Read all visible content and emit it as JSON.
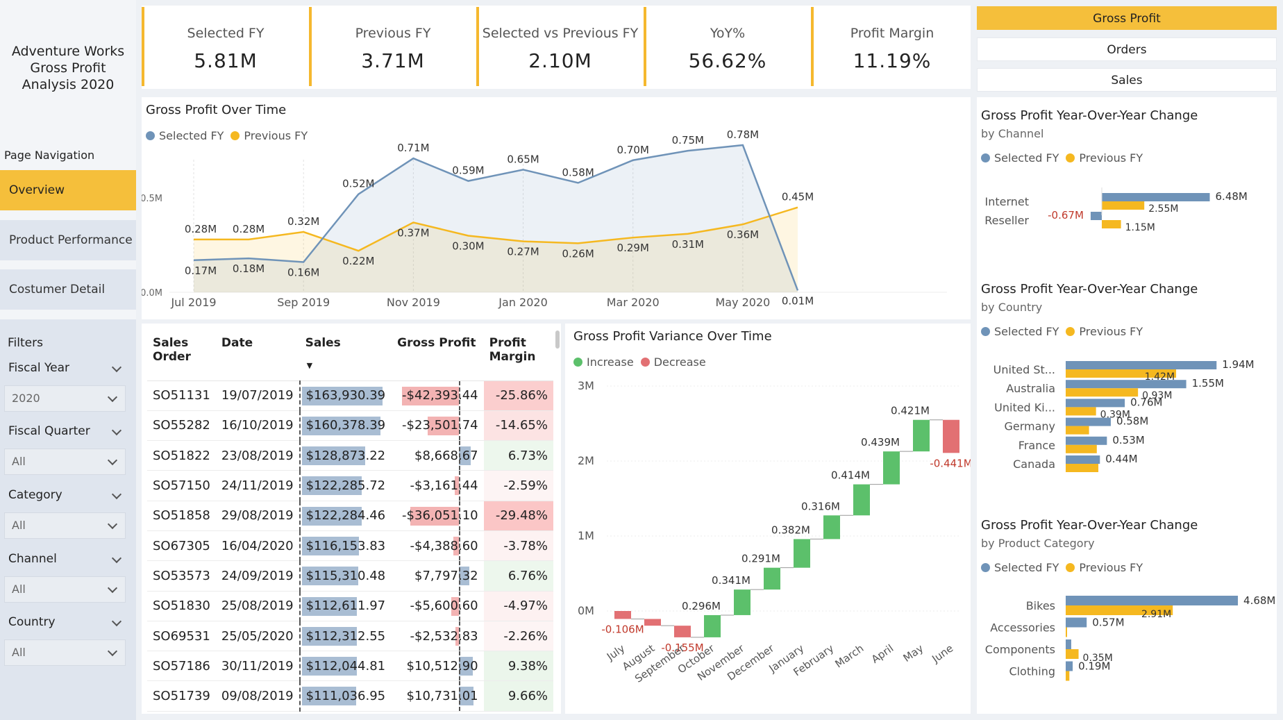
{
  "app": {
    "title_lines": [
      "Adventure Works",
      "Gross Profit",
      "Analysis 2020"
    ]
  },
  "navigation": {
    "heading": "Page Navigation",
    "items": [
      {
        "label": "Overview",
        "active": true
      },
      {
        "label": "Product Performance",
        "active": false
      },
      {
        "label": "Costumer Detail",
        "active": false
      }
    ]
  },
  "filters": {
    "heading": "Filters",
    "items": [
      {
        "label": "Fiscal Year",
        "value": "2020"
      },
      {
        "label": "Fiscal Quarter",
        "value": "All"
      },
      {
        "label": "Category",
        "value": "All"
      },
      {
        "label": "Channel",
        "value": "All"
      },
      {
        "label": "Country",
        "value": "All"
      }
    ]
  },
  "kpis": [
    {
      "label": "Selected FY",
      "value": "5.81M"
    },
    {
      "label": "Previous FY",
      "value": "3.71M"
    },
    {
      "label": "Selected vs Previous FY",
      "value": "2.10M"
    },
    {
      "label": "YoY%",
      "value": "56.62%"
    },
    {
      "label": "Profit Margin",
      "value": "11.19%"
    }
  ],
  "measure_buttons": [
    {
      "label": "Gross Profit",
      "active": true
    },
    {
      "label": "Orders",
      "active": false
    },
    {
      "label": "Sales",
      "active": false
    }
  ],
  "colors": {
    "selected": "#6f93b8",
    "previous": "#f5b820",
    "increase": "#5cc06b",
    "decrease": "#e27073",
    "accent": "#f5bf3b"
  },
  "legend": {
    "selected": "Selected FY",
    "previous": "Previous FY",
    "increase": "Increase",
    "decrease": "Decrease"
  },
  "chart_data": [
    {
      "id": "gp-over-time",
      "type": "line",
      "title": "Gross Profit Over Time",
      "y_ticks": [
        "0.5M",
        "0.0M"
      ],
      "x_ticks": [
        "Jul 2019",
        "Sep 2019",
        "Nov 2019",
        "Jan 2020",
        "Mar 2020",
        "May 2020"
      ],
      "ylim": [
        0,
        0.85
      ],
      "series": [
        {
          "name": "Selected FY",
          "values": [
            0.17,
            0.18,
            0.16,
            0.52,
            0.71,
            0.59,
            0.65,
            0.58,
            0.7,
            0.75,
            0.78,
            0.01
          ],
          "labels": [
            "0.17M",
            "0.18M",
            "0.16M",
            "0.52M",
            "0.71M",
            "0.59M",
            "0.65M",
            "0.58M",
            "0.70M",
            "0.75M",
            "0.78M",
            "0.01M"
          ]
        },
        {
          "name": "Previous FY",
          "values": [
            0.28,
            0.28,
            0.32,
            0.22,
            0.37,
            0.3,
            0.27,
            0.26,
            0.29,
            0.31,
            0.36,
            0.45
          ],
          "labels": [
            "0.28M",
            "0.28M",
            "0.32M",
            "0.22M",
            "0.37M",
            "0.30M",
            "0.27M",
            "0.26M",
            "0.29M",
            "0.31M",
            "0.36M",
            "0.45M"
          ]
        }
      ]
    },
    {
      "id": "variance-waterfall",
      "type": "bar",
      "title": "Gross Profit Variance Over Time",
      "y_ticks": [
        "3M",
        "2M",
        "1M",
        "0M"
      ],
      "ylim": [
        -0.4,
        3.0
      ],
      "categories": [
        "July",
        "August",
        "September",
        "October",
        "November",
        "December",
        "January",
        "February",
        "March",
        "April",
        "May",
        "June"
      ],
      "values": [
        -0.106,
        -0.09,
        -0.155,
        0.296,
        0.341,
        0.291,
        0.382,
        0.316,
        0.414,
        0.439,
        0.421,
        -0.441
      ],
      "labels": [
        "-0.106M",
        "",
        "-0.155M",
        "0.296M",
        "0.341M",
        "0.291M",
        "0.382M",
        "0.316M",
        "0.414M",
        "0.439M",
        "0.421M",
        "-0.441M"
      ]
    },
    {
      "id": "yoy-channel",
      "type": "bar",
      "title": "Gross Profit Year-Over-Year Change",
      "subtitle": "by Channel",
      "categories": [
        "Internet",
        "Reseller"
      ],
      "series": [
        {
          "name": "Selected FY",
          "values": [
            6.48,
            -0.67
          ],
          "labels": [
            "6.48M",
            "-0.67M"
          ]
        },
        {
          "name": "Previous FY",
          "values": [
            2.55,
            1.15
          ],
          "labels": [
            "2.55M",
            "1.15M"
          ]
        }
      ]
    },
    {
      "id": "yoy-country",
      "type": "bar",
      "title": "Gross Profit Year-Over-Year Change",
      "subtitle": "by Country",
      "categories": [
        "United St...",
        "Australia",
        "United Ki...",
        "Germany",
        "France",
        "Canada"
      ],
      "series": [
        {
          "name": "Selected FY",
          "values": [
            1.94,
            1.55,
            0.76,
            0.58,
            0.53,
            0.44
          ],
          "labels": [
            "1.94M",
            "1.55M",
            "0.76M",
            "0.58M",
            "0.53M",
            "0.44M"
          ]
        },
        {
          "name": "Previous FY",
          "values": [
            1.42,
            0.93,
            0.39,
            0.3,
            0.4,
            0.42
          ],
          "labels": [
            "1.42M",
            "0.93M",
            "0.39M",
            "",
            "",
            ""
          ]
        }
      ]
    },
    {
      "id": "yoy-category",
      "type": "bar",
      "title": "Gross Profit Year-Over-Year Change",
      "subtitle": "by Product Category",
      "categories": [
        "Bikes",
        "Accessories",
        "Components",
        "Clothing"
      ],
      "series": [
        {
          "name": "Selected FY",
          "values": [
            4.68,
            0.57,
            0.15,
            0.19
          ],
          "labels": [
            "4.68M",
            "0.57M",
            "",
            "0.19M"
          ]
        },
        {
          "name": "Previous FY",
          "values": [
            2.91,
            0.02,
            0.35,
            0.1
          ],
          "labels": [
            "2.91M",
            "",
            "0.35M",
            ""
          ]
        }
      ]
    }
  ],
  "orders_table": {
    "headers": [
      "Sales Order",
      "Date",
      "Sales",
      "Gross Profit",
      "Profit Margin"
    ],
    "rows": [
      {
        "order": "SO51131",
        "date": "19/07/2019",
        "sales": "$163,930.39",
        "sales_v": 163930.39,
        "gp": "-$42,393.44",
        "gp_v": -42393.44,
        "margin": "-25.86%",
        "margin_v": -25.86
      },
      {
        "order": "SO55282",
        "date": "16/10/2019",
        "sales": "$160,378.39",
        "sales_v": 160378.39,
        "gp": "-$23,501.74",
        "gp_v": -23501.74,
        "margin": "-14.65%",
        "margin_v": -14.65
      },
      {
        "order": "SO51822",
        "date": "23/08/2019",
        "sales": "$128,873.22",
        "sales_v": 128873.22,
        "gp": "$8,668.67",
        "gp_v": 8668.67,
        "margin": "6.73%",
        "margin_v": 6.73
      },
      {
        "order": "SO57150",
        "date": "24/11/2019",
        "sales": "$122,285.72",
        "sales_v": 122285.72,
        "gp": "-$3,161.44",
        "gp_v": -3161.44,
        "margin": "-2.59%",
        "margin_v": -2.59
      },
      {
        "order": "SO51858",
        "date": "29/08/2019",
        "sales": "$122,284.46",
        "sales_v": 122284.46,
        "gp": "-$36,051.10",
        "gp_v": -36051.1,
        "margin": "-29.48%",
        "margin_v": -29.48
      },
      {
        "order": "SO67305",
        "date": "16/04/2020",
        "sales": "$116,153.83",
        "sales_v": 116153.83,
        "gp": "-$4,388.60",
        "gp_v": -4388.6,
        "margin": "-3.78%",
        "margin_v": -3.78
      },
      {
        "order": "SO53573",
        "date": "24/09/2019",
        "sales": "$115,310.48",
        "sales_v": 115310.48,
        "gp": "$7,797.32",
        "gp_v": 7797.32,
        "margin": "6.76%",
        "margin_v": 6.76
      },
      {
        "order": "SO51830",
        "date": "25/08/2019",
        "sales": "$112,611.97",
        "sales_v": 112611.97,
        "gp": "-$5,600.60",
        "gp_v": -5600.6,
        "margin": "-4.97%",
        "margin_v": -4.97
      },
      {
        "order": "SO69531",
        "date": "25/05/2020",
        "sales": "$112,312.55",
        "sales_v": 112312.55,
        "gp": "-$2,532.83",
        "gp_v": -2532.83,
        "margin": "-2.26%",
        "margin_v": -2.26
      },
      {
        "order": "SO57186",
        "date": "30/11/2019",
        "sales": "$112,044.81",
        "sales_v": 112044.81,
        "gp": "$10,512.90",
        "gp_v": 10512.9,
        "margin": "9.38%",
        "margin_v": 9.38
      },
      {
        "order": "SO51739",
        "date": "09/08/2019",
        "sales": "$111,036.95",
        "sales_v": 111036.95,
        "gp": "$10,731.01",
        "gp_v": 10731.01,
        "margin": "9.66%",
        "margin_v": 9.66
      }
    ]
  }
}
